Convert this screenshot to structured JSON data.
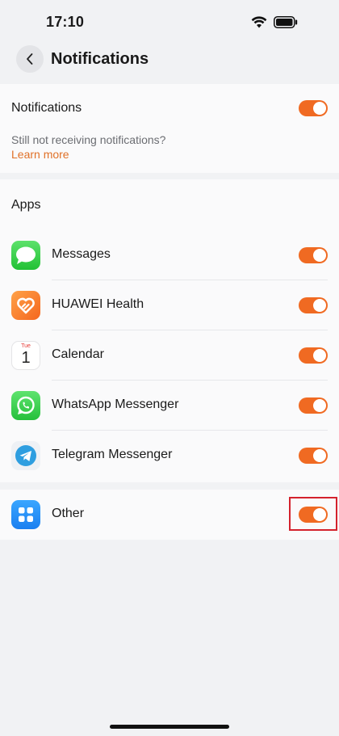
{
  "status_bar": {
    "time": "17:10"
  },
  "header": {
    "title": "Notifications"
  },
  "notifications": {
    "label": "Notifications",
    "enabled": true,
    "hint": "Still not receiving notifications?",
    "learn_more": "Learn more"
  },
  "apps": {
    "heading": "Apps",
    "items": [
      {
        "name": "Messages",
        "enabled": true,
        "icon": "messages-icon"
      },
      {
        "name": "HUAWEI Health",
        "enabled": true,
        "icon": "huawei-health-icon"
      },
      {
        "name": "Calendar",
        "enabled": true,
        "icon": "calendar-icon",
        "icon_day": "Tue",
        "icon_date": "1"
      },
      {
        "name": "WhatsApp Messenger",
        "enabled": true,
        "icon": "whatsapp-icon"
      },
      {
        "name": "Telegram Messenger",
        "enabled": true,
        "icon": "telegram-icon"
      }
    ]
  },
  "other": {
    "name": "Other",
    "enabled": true,
    "icon": "other-apps-icon"
  },
  "colors": {
    "accent": "#f06a22",
    "link": "#e07128",
    "highlight": "#d4222d"
  }
}
